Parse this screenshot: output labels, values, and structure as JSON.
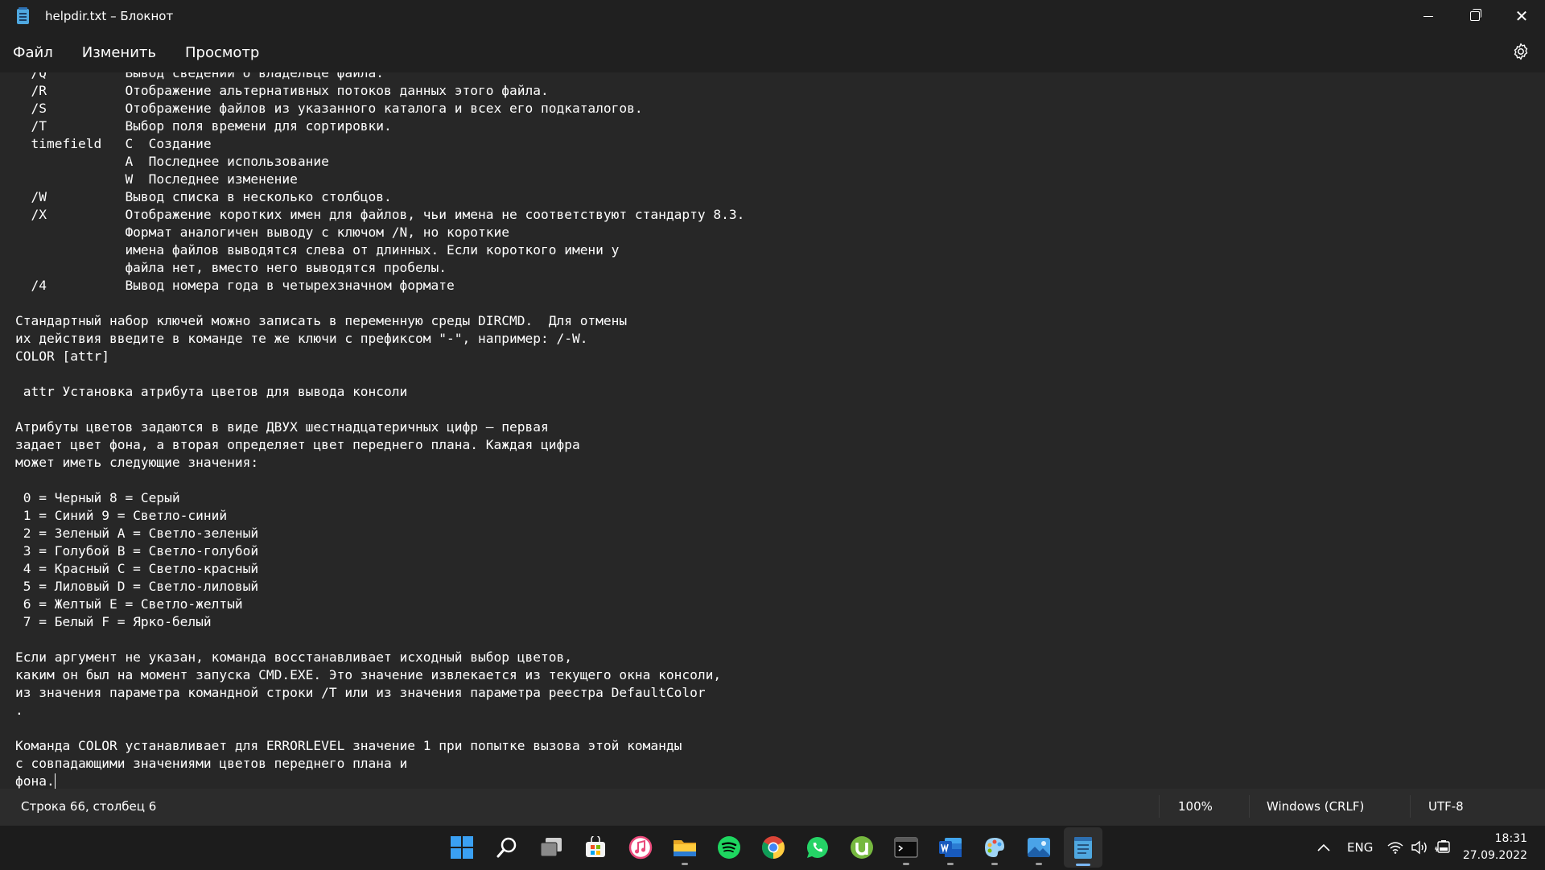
{
  "window": {
    "title": "helpdir.txt – Блокнот"
  },
  "menu": {
    "file": "Файл",
    "edit": "Изменить",
    "view": "Просмотр"
  },
  "editor": {
    "content": "  /Q          Вывод сведений о владельце файла.\n  /R          Отображение альтернативных потоков данных этого файла.\n  /S          Отображение файлов из указанного каталога и всех его подкаталогов.\n  /T          Выбор поля времени для сортировки.\n  timefield   C  Создание\n              A  Последнее использование\n              W  Последнее изменение\n  /W          Вывод списка в несколько столбцов.\n  /X          Отображение коротких имен для файлов, чьи имена не соответствуют стандарту 8.3.\n              Формат аналогичен выводу с ключом /N, но короткие\n              имена файлов выводятся слева от длинных. Если короткого имени у\n              файла нет, вместо него выводятся пробелы.\n  /4          Вывод номера года в четырехзначном формате\n\nСтандартный набор ключей можно записать в переменную среды DIRCMD.  Для отмены\nих действия введите в команде те же ключи с префиксом \"-\", например: /-W.\nCOLOR [attr]\n\n attr Установка атрибута цветов для вывода консоли\n\nАтрибуты цветов задаются в виде ДВУХ шестнадцатеричных цифр — первая\nзадает цвет фона, а вторая определяет цвет переднего плана. Каждая цифра\nможет иметь следующие значения:\n\n 0 = Черный 8 = Серый\n 1 = Синий 9 = Светло-синий\n 2 = Зеленый A = Светло-зеленый\n 3 = Голубой B = Светло-голубой\n 4 = Красный C = Светло-красный\n 5 = Лиловый D = Светло-лиловый\n 6 = Желтый E = Светло-желтый\n 7 = Белый F = Ярко-белый\n\nЕсли аргумент не указан, команда восстанавливает исходный выбор цветов,\nкаким он был на момент запуска CMD.EXE. Это значение извлекается из текущего окна консоли,\nиз значения параметра командной строки /T или из значения параметра реестра DefaultColor\n.\n\nКоманда COLOR устанавливает для ERRORLEVEL значение 1 при попытке вызова этой команды\nс совпадающими значениями цветов переднего плана и\nфона."
  },
  "status": {
    "position": "Строка 66, столбец 6",
    "zoom": "100%",
    "line_ending": "Windows (CRLF)",
    "encoding": "UTF-8"
  },
  "taskbar": {
    "language": "ENG",
    "time": "18:31",
    "date": "27.09.2022",
    "apps": [
      "windows-start",
      "search",
      "task-view",
      "microsoft-store",
      "itunes",
      "file-explorer",
      "spotify",
      "chrome",
      "whatsapp",
      "utorrent",
      "terminal",
      "word",
      "paint-3d",
      "photos",
      "notepad"
    ]
  },
  "colors": {
    "background": "#272727",
    "chrome": "#202020",
    "statusbar": "#2c2c2c",
    "taskbar": "#1c1c1c",
    "accent": "#7ab8f5"
  }
}
